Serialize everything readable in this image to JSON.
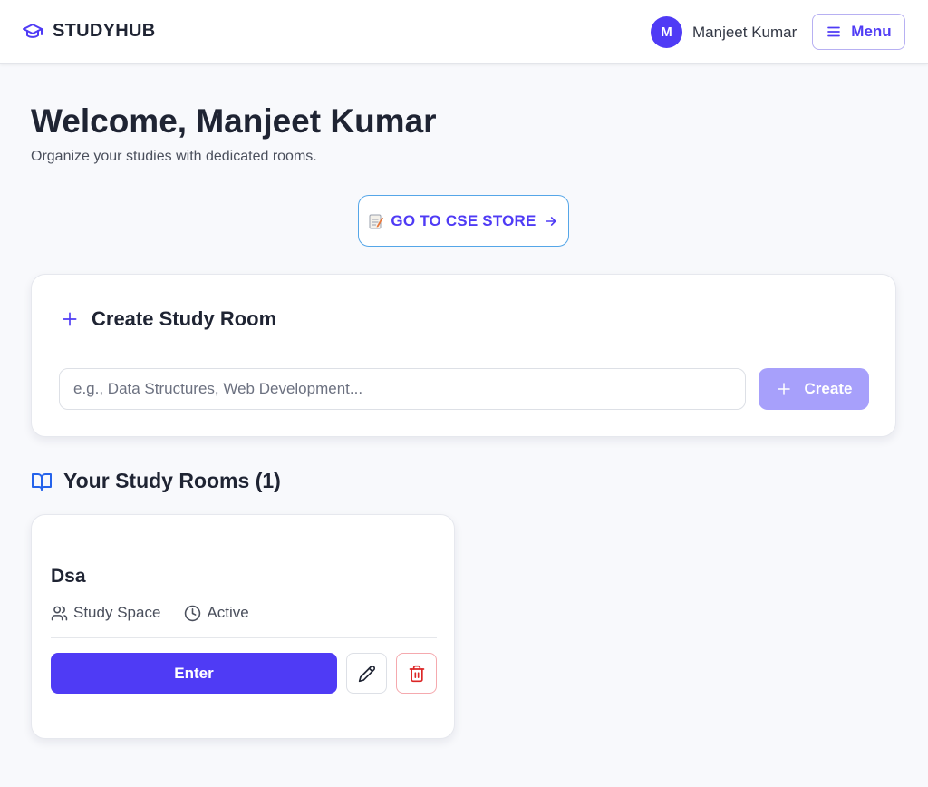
{
  "header": {
    "brand": "STUDYHUB",
    "user_initial": "M",
    "user_name": "Manjeet Kumar",
    "menu_label": "Menu"
  },
  "main": {
    "welcome": "Welcome, Manjeet Kumar",
    "subtitle": "Organize your studies with dedicated rooms.",
    "store_button": "GO TO CSE STORE"
  },
  "create_room": {
    "title": "Create Study Room",
    "placeholder": "e.g., Data Structures, Web Development...",
    "value": "",
    "button": "Create"
  },
  "rooms": {
    "heading": "Your Study Rooms (1)",
    "items": [
      {
        "name": "Dsa",
        "type": "Study Space",
        "status": "Active",
        "enter_label": "Enter"
      }
    ]
  },
  "colors": {
    "accent": "#4f3bf5",
    "accent_disabled": "#a7a0fb",
    "store_border": "#55a6e8",
    "danger": "#dc2626",
    "heading_icon_blue": "#2563eb"
  },
  "icons": {
    "brand": "graduation-cap-icon",
    "menu": "hamburger-icon",
    "store": "memo-icon",
    "store_arrow": "arrow-right-icon",
    "create": "plus-icon",
    "rooms": "book-open-icon",
    "type": "users-icon",
    "status": "clock-icon",
    "edit": "pencil-icon",
    "delete": "trash-icon"
  }
}
